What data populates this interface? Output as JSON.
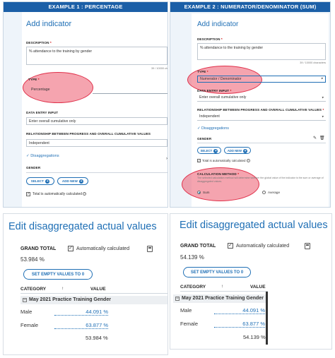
{
  "example1": {
    "header": "EXAMPLE 1 : PERCENTAGE",
    "add_indicator": "Add indicator",
    "description_label": "DESCRIPTION",
    "required_mark": "*",
    "description_value": "% attendance to the training by gender",
    "char_counter": "39 / 10000 ch",
    "type_label": "TYPE",
    "type_value": "Percentage",
    "data_entry_label": "DATA ENTRY INPUT",
    "data_entry_value": "Enter overall cumulative only",
    "relationship_label": "RELATIONSHIP BETWEEN PROGRESS AND OVERALL CUMULATIVE VALUES",
    "relationship_value": "Independent",
    "disaggregations": "Disaggregations",
    "gender_label": "GENDER",
    "select_btn": "SELECT",
    "add_new_btn": "ADD NEW",
    "total_auto": "Total is automatically calculated"
  },
  "example2": {
    "header": "EXAMPLE 2 : NUMERATOR/DENOMINATOR (SUM)",
    "add_indicator": "Add indicator",
    "description_label": "DESCRIPTION",
    "required_mark": "*",
    "description_value": "% attendance to the training by gender",
    "char_counter": "39 / 10000 characters",
    "type_label": "TYPE",
    "type_value": "Numerator / Denominator",
    "data_entry_label": "DATA ENTRY INPUT",
    "data_entry_value": "Enter overall cumulative only",
    "relationship_label": "RELATIONSHIP BETWEEN PROGRESS AND OVERALL CUMULATIVE VALUES",
    "relationship_value": "Independent",
    "disaggregations": "Disaggregations",
    "gender_label": "GENDER",
    "select_btn": "SELECT",
    "add_new_btn": "ADD NEW",
    "total_auto": "Total is automatically calculated",
    "calc_method_label": "CALCULATION METHOD",
    "calc_method_help": "The selected calculation method will determine whether the global value of the indicator is the sum or average of disaggregated values.",
    "sum_label": "Sum",
    "average_label": "Average"
  },
  "bottom_left": {
    "title": "Edit disaggregated actual values",
    "grand_total_label": "GRAND TOTAL",
    "auto_calc_label": "Automatically calculated",
    "grand_total_value": "53.984 %",
    "set_empty_btn": "SET EMPTY VALUES TO 0",
    "col_category": "CATEGORY",
    "sort_arrow": "↑",
    "col_value": "VALUE",
    "group_name": "May 2021 Practice Training Gender",
    "rows": [
      {
        "label": "Male",
        "value": "44.091 %"
      },
      {
        "label": "Female",
        "value": "63.877 %"
      }
    ],
    "total": "53.984 %"
  },
  "bottom_right": {
    "title": "Edit disaggregated actual values",
    "grand_total_label": "GRAND TOTAL",
    "auto_calc_label": "Automatically calculated",
    "grand_total_value": "54.139 %",
    "set_empty_btn": "SET EMPTY VALUES TO 0",
    "col_category": "CATEGORY",
    "sort_arrow": "↑",
    "col_value": "VALUE",
    "group_name": "May 2021 Practice Training Gender",
    "rows": [
      {
        "label": "Male",
        "value": "44.091 %"
      },
      {
        "label": "Female",
        "value": "63.877 %"
      }
    ],
    "total": "54.139 %"
  },
  "colors": {
    "accent": "#1f6fb5",
    "header_bar": "#1b5fa7",
    "highlight_oval": "#e0304a"
  }
}
